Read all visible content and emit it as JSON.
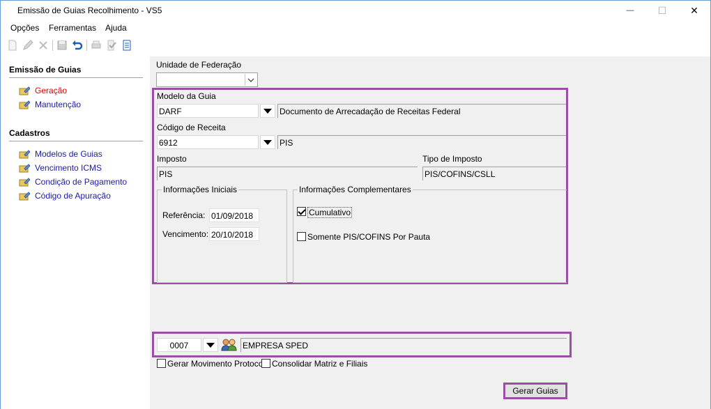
{
  "window": {
    "title": "Emissão de Guias Recolhimento - VS5",
    "minimize": "—",
    "maximize": "☐",
    "close": "✕"
  },
  "menu": {
    "opcoes": "Opções",
    "ferramentas": "Ferramentas",
    "ajuda": "Ajuda"
  },
  "sidebar": {
    "section1": "Emissão de Guias",
    "items1": [
      "Geração",
      "Manutenção"
    ],
    "section2": "Cadastros",
    "items2": [
      "Modelos de Guias",
      "Vencimento ICMS",
      "Condição de Pagamento",
      "Código de Apuração"
    ]
  },
  "form": {
    "uf_label": "Unidade de Federação",
    "uf_value": "",
    "modelo_label": "Modelo da Guia",
    "modelo_value": "DARF",
    "modelo_desc": "Documento de Arrecadação de Receitas Federal",
    "codigo_label": "Código de Receita",
    "codigo_value": "6912",
    "codigo_desc": "PIS",
    "imposto_label": "Imposto",
    "imposto_value": "PIS",
    "tipo_label": "Tipo de Imposto",
    "tipo_value": "PIS/COFINS/CSLL",
    "info_iniciais": "Informações Iniciais",
    "referencia_label": "Referência:",
    "referencia_value": "01/09/2018",
    "vencimento_label": "Vencimento:",
    "vencimento_value": "20/10/2018",
    "info_compl": "Informações Complementares",
    "cumulativo": "Cumulativo",
    "cumulativo_checked": true,
    "somente": "Somente PIS/COFINS Por Pauta",
    "somente_checked": false,
    "empresa_code": "0007",
    "empresa_name": "EMPRESA SPED",
    "gerar_mov": "Gerar Movimento Protocolo",
    "consolidar": "Consolidar Matriz e Filiais",
    "gerar_btn": "Gerar Guias"
  },
  "colors": {
    "highlight": "#9a4fa5",
    "link": "#1a1aa6",
    "active_link": "#e00000"
  }
}
